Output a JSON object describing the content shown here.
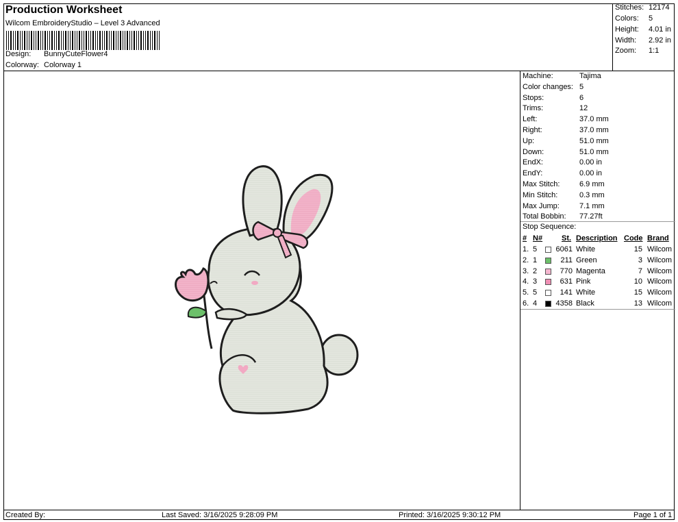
{
  "header": {
    "title": "Production Worksheet",
    "subtitle": "Wilcom EmbroideryStudio – Level 3 Advanced",
    "design_label": "Design:",
    "design_value": "BunnyCuteFlower4",
    "colorway_label": "Colorway:",
    "colorway_value": "Colorway 1"
  },
  "stats": {
    "stitches_label": "Stitches:",
    "stitches_value": "12174",
    "colors_label": "Colors:",
    "colors_value": "5",
    "height_label": "Height:",
    "height_value": "4.01 in",
    "width_label": "Width:",
    "width_value": "2.92 in",
    "zoom_label": "Zoom:",
    "zoom_value": "1:1"
  },
  "info": [
    {
      "label": "Machine:",
      "value": "Tajima"
    },
    {
      "label": "Color changes:",
      "value": "5"
    },
    {
      "label": "Stops:",
      "value": "6"
    },
    {
      "label": "Trims:",
      "value": "12"
    },
    {
      "label": "Left:",
      "value": "37.0 mm"
    },
    {
      "label": "Right:",
      "value": "37.0 mm"
    },
    {
      "label": "Up:",
      "value": "51.0 mm"
    },
    {
      "label": "Down:",
      "value": "51.0 mm"
    },
    {
      "label": "EndX:",
      "value": "0.00 in"
    },
    {
      "label": "EndY:",
      "value": "0.00 in"
    },
    {
      "label": "Max Stitch:",
      "value": "6.9 mm"
    },
    {
      "label": "Min Stitch:",
      "value": "0.3 mm"
    },
    {
      "label": "Max Jump:",
      "value": "7.1 mm"
    },
    {
      "label": "Total Bobbin:",
      "value": "77.27ft"
    }
  ],
  "stop_sequence": {
    "title": "Stop Sequence:",
    "headers": {
      "num": "#",
      "n": "N#",
      "st": "St.",
      "description": "Description",
      "code": "Code",
      "brand": "Brand"
    },
    "rows": [
      {
        "num": "1.",
        "n": "5",
        "color": "#ffffff",
        "st": "6061",
        "description": "White",
        "code": "15",
        "brand": "Wilcom"
      },
      {
        "num": "2.",
        "n": "1",
        "color": "#6cc06a",
        "st": "211",
        "description": "Green",
        "code": "3",
        "brand": "Wilcom"
      },
      {
        "num": "3.",
        "n": "2",
        "color": "#f5b6cf",
        "st": "770",
        "description": "Magenta",
        "code": "7",
        "brand": "Wilcom"
      },
      {
        "num": "4.",
        "n": "3",
        "color": "#ef8fb4",
        "st": "631",
        "description": "Pink",
        "code": "10",
        "brand": "Wilcom"
      },
      {
        "num": "5.",
        "n": "5",
        "color": "#ffffff",
        "st": "141",
        "description": "White",
        "code": "15",
        "brand": "Wilcom"
      },
      {
        "num": "6.",
        "n": "4",
        "color": "#000000",
        "st": "4358",
        "description": "Black",
        "code": "13",
        "brand": "Wilcom"
      }
    ]
  },
  "footer": {
    "created_by": "Created By:",
    "last_saved": "Last Saved: 3/16/2025 9:28:09 PM",
    "printed": "Printed: 3/16/2025 9:30:12 PM",
    "page": "Page 1 of 1"
  },
  "colors": {
    "bunny_fill": "#e3e6de",
    "outline": "#1e1e1e",
    "pink": "#f2a9c3",
    "pink_light": "#f7c9d8",
    "leaf_green": "#6cc06a"
  }
}
